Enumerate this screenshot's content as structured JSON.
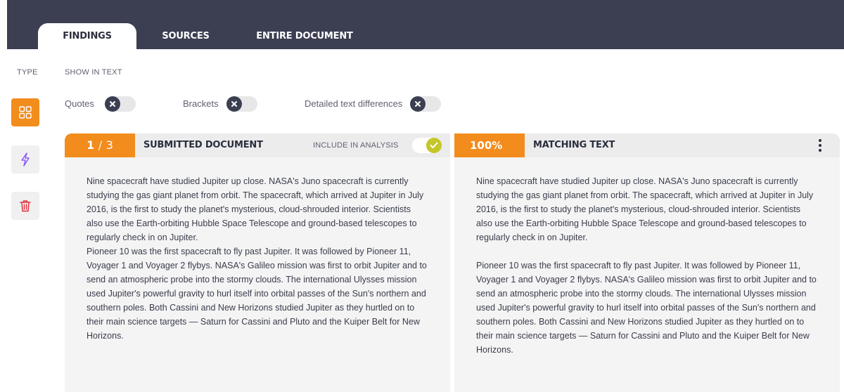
{
  "tabs": [
    {
      "label": "FINDINGS",
      "active": true
    },
    {
      "label": "SOURCES",
      "active": false
    },
    {
      "label": "ENTIRE DOCUMENT",
      "active": false
    }
  ],
  "sidebar": {
    "type_label": "TYPE",
    "buttons": [
      {
        "icon": "grid-icon",
        "active": true
      },
      {
        "icon": "lightning-icon",
        "active": false
      },
      {
        "icon": "trash-icon",
        "active": false
      }
    ]
  },
  "show_in_text": {
    "label": "SHOW IN TEXT",
    "options": [
      {
        "label": "Quotes",
        "enabled": false
      },
      {
        "label": "Brackets",
        "enabled": false
      },
      {
        "label": "Detailed text differences",
        "enabled": false
      }
    ]
  },
  "left_panel": {
    "current": "1",
    "separator": "/",
    "total": "3",
    "title": "SUBMITTED DOCUMENT",
    "include_label": "INCLUDE IN ANALYSIS",
    "include_enabled": true,
    "paragraphs": [
      "Nine spacecraft have studied Jupiter up close. NASA's Juno spacecraft is currently studying the gas giant planet from orbit. The spacecraft, which arrived at Jupiter in July 2016, is the first to study the planet's mysterious, cloud-shrouded interior. Scientists also use the Earth-orbiting Hubble Space Telescope and ground-based telescopes to regularly check in on Jupiter.",
      "Pioneer 10 was the first spacecraft to fly past Jupiter. It was followed by Pioneer 11, Voyager 1 and Voyager 2 flybys. NASA's Galileo mission was first to orbit Jupiter and to send an atmospheric probe into the stormy clouds. The international Ulysses mission used Jupiter's powerful gravity to hurl itself into orbital passes of the Sun's northern and southern poles. Both Cassini and New Horizons studied Jupiter as they hurtled on to their main science targets — Saturn for Cassini and Pluto and the Kuiper Belt for New Horizons."
    ]
  },
  "right_panel": {
    "percent": "100%",
    "title": "MATCHING TEXT",
    "paragraphs": [
      "Nine spacecraft have studied Jupiter up close. NASA's Juno spacecraft is currently studying the gas giant planet from orbit. The spacecraft, which arrived at Jupiter in July 2016, is the first to study the planet's mysterious, cloud-shrouded interior. Scientists also use the Earth-orbiting Hubble Space Telescope and ground-based telescopes to regularly check in on Jupiter.",
      "Pioneer 10 was the first spacecraft to fly past Jupiter. It was followed by Pioneer 11, Voyager 1 and Voyager 2 flybys. NASA's Galileo mission was first to orbit Jupiter and to send an atmospheric probe into the stormy clouds. The international Ulysses mission used Jupiter's powerful gravity to hurl itself into orbital passes of the Sun's northern and southern poles. Both Cassini and New Horizons studied Jupiter as they hurtled on to their main science targets — Saturn for Cassini and Pluto and the Kuiper Belt for New Horizons."
    ]
  },
  "colors": {
    "accent": "#f28c1c",
    "topbar": "#3c3f52",
    "include_toggle": "#c5c62a",
    "bolt_icon": "#8b5cf6",
    "trash_icon": "#e0313b"
  }
}
